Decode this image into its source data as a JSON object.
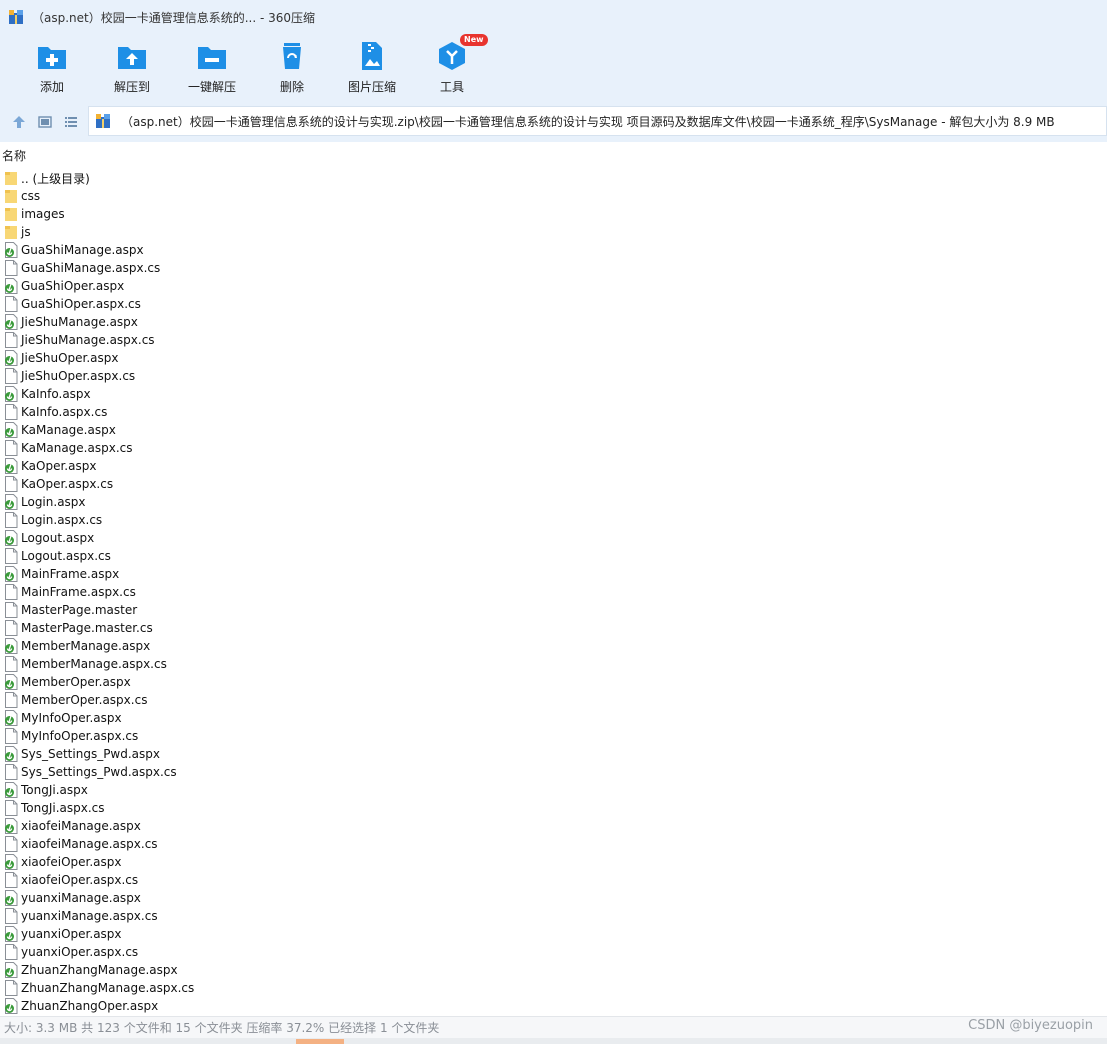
{
  "window": {
    "title": "（asp.net）校园一卡通管理信息系统的... - 360压缩",
    "app_icon": "archive-app-icon"
  },
  "toolbar": {
    "items": [
      {
        "label": "添加",
        "icon": "folder-plus-icon"
      },
      {
        "label": "解压到",
        "icon": "folder-upload-icon"
      },
      {
        "label": "一键解压",
        "icon": "folder-minus-icon"
      },
      {
        "label": "删除",
        "icon": "recycle-bin-icon"
      },
      {
        "label": "图片压缩",
        "icon": "image-zip-icon"
      },
      {
        "label": "工具",
        "icon": "tools-cube-icon",
        "badge": "New"
      }
    ],
    "accent": "#1e8fe6",
    "badge_color": "#e8342e"
  },
  "address": {
    "path": "（asp.net）校园一卡通管理信息系统的设计与实现.zip\\校园一卡通管理信息系统的设计与实现 项目源码及数据库文件\\校园一卡通系统_程序\\SysManage - 解包大小为 8.9 MB"
  },
  "list": {
    "column_name": "名称",
    "items": [
      {
        "name": ".. (上级目录)",
        "type": "folder"
      },
      {
        "name": "css",
        "type": "folder"
      },
      {
        "name": "images",
        "type": "folder"
      },
      {
        "name": "js",
        "type": "folder"
      },
      {
        "name": "GuaShiManage.aspx",
        "type": "aspx"
      },
      {
        "name": "GuaShiManage.aspx.cs",
        "type": "file"
      },
      {
        "name": "GuaShiOper.aspx",
        "type": "aspx"
      },
      {
        "name": "GuaShiOper.aspx.cs",
        "type": "file"
      },
      {
        "name": "JieShuManage.aspx",
        "type": "aspx"
      },
      {
        "name": "JieShuManage.aspx.cs",
        "type": "file"
      },
      {
        "name": "JieShuOper.aspx",
        "type": "aspx"
      },
      {
        "name": "JieShuOper.aspx.cs",
        "type": "file"
      },
      {
        "name": "KaInfo.aspx",
        "type": "aspx"
      },
      {
        "name": "KaInfo.aspx.cs",
        "type": "file"
      },
      {
        "name": "KaManage.aspx",
        "type": "aspx"
      },
      {
        "name": "KaManage.aspx.cs",
        "type": "file"
      },
      {
        "name": "KaOper.aspx",
        "type": "aspx"
      },
      {
        "name": "KaOper.aspx.cs",
        "type": "file"
      },
      {
        "name": "Login.aspx",
        "type": "aspx"
      },
      {
        "name": "Login.aspx.cs",
        "type": "file"
      },
      {
        "name": "Logout.aspx",
        "type": "aspx"
      },
      {
        "name": "Logout.aspx.cs",
        "type": "file"
      },
      {
        "name": "MainFrame.aspx",
        "type": "aspx"
      },
      {
        "name": "MainFrame.aspx.cs",
        "type": "file"
      },
      {
        "name": "MasterPage.master",
        "type": "file"
      },
      {
        "name": "MasterPage.master.cs",
        "type": "file"
      },
      {
        "name": "MemberManage.aspx",
        "type": "aspx"
      },
      {
        "name": "MemberManage.aspx.cs",
        "type": "file"
      },
      {
        "name": "MemberOper.aspx",
        "type": "aspx"
      },
      {
        "name": "MemberOper.aspx.cs",
        "type": "file"
      },
      {
        "name": "MyInfoOper.aspx",
        "type": "aspx"
      },
      {
        "name": "MyInfoOper.aspx.cs",
        "type": "file"
      },
      {
        "name": "Sys_Settings_Pwd.aspx",
        "type": "aspx"
      },
      {
        "name": "Sys_Settings_Pwd.aspx.cs",
        "type": "file"
      },
      {
        "name": "TongJi.aspx",
        "type": "aspx"
      },
      {
        "name": "TongJi.aspx.cs",
        "type": "file"
      },
      {
        "name": "xiaofeiManage.aspx",
        "type": "aspx"
      },
      {
        "name": "xiaofeiManage.aspx.cs",
        "type": "file"
      },
      {
        "name": "xiaofeiOper.aspx",
        "type": "aspx"
      },
      {
        "name": "xiaofeiOper.aspx.cs",
        "type": "file"
      },
      {
        "name": "yuanxiManage.aspx",
        "type": "aspx"
      },
      {
        "name": "yuanxiManage.aspx.cs",
        "type": "file"
      },
      {
        "name": "yuanxiOper.aspx",
        "type": "aspx"
      },
      {
        "name": "yuanxiOper.aspx.cs",
        "type": "file"
      },
      {
        "name": "ZhuanZhangManage.aspx",
        "type": "aspx"
      },
      {
        "name": "ZhuanZhangManage.aspx.cs",
        "type": "file"
      },
      {
        "name": "ZhuanZhangOper.aspx",
        "type": "aspx"
      }
    ]
  },
  "status": {
    "text": "大小: 3.3 MB 共 123 个文件和 15 个文件夹 压缩率 37.2% 已经选择 1 个文件夹"
  },
  "watermark": "CSDN @biyezuopin"
}
